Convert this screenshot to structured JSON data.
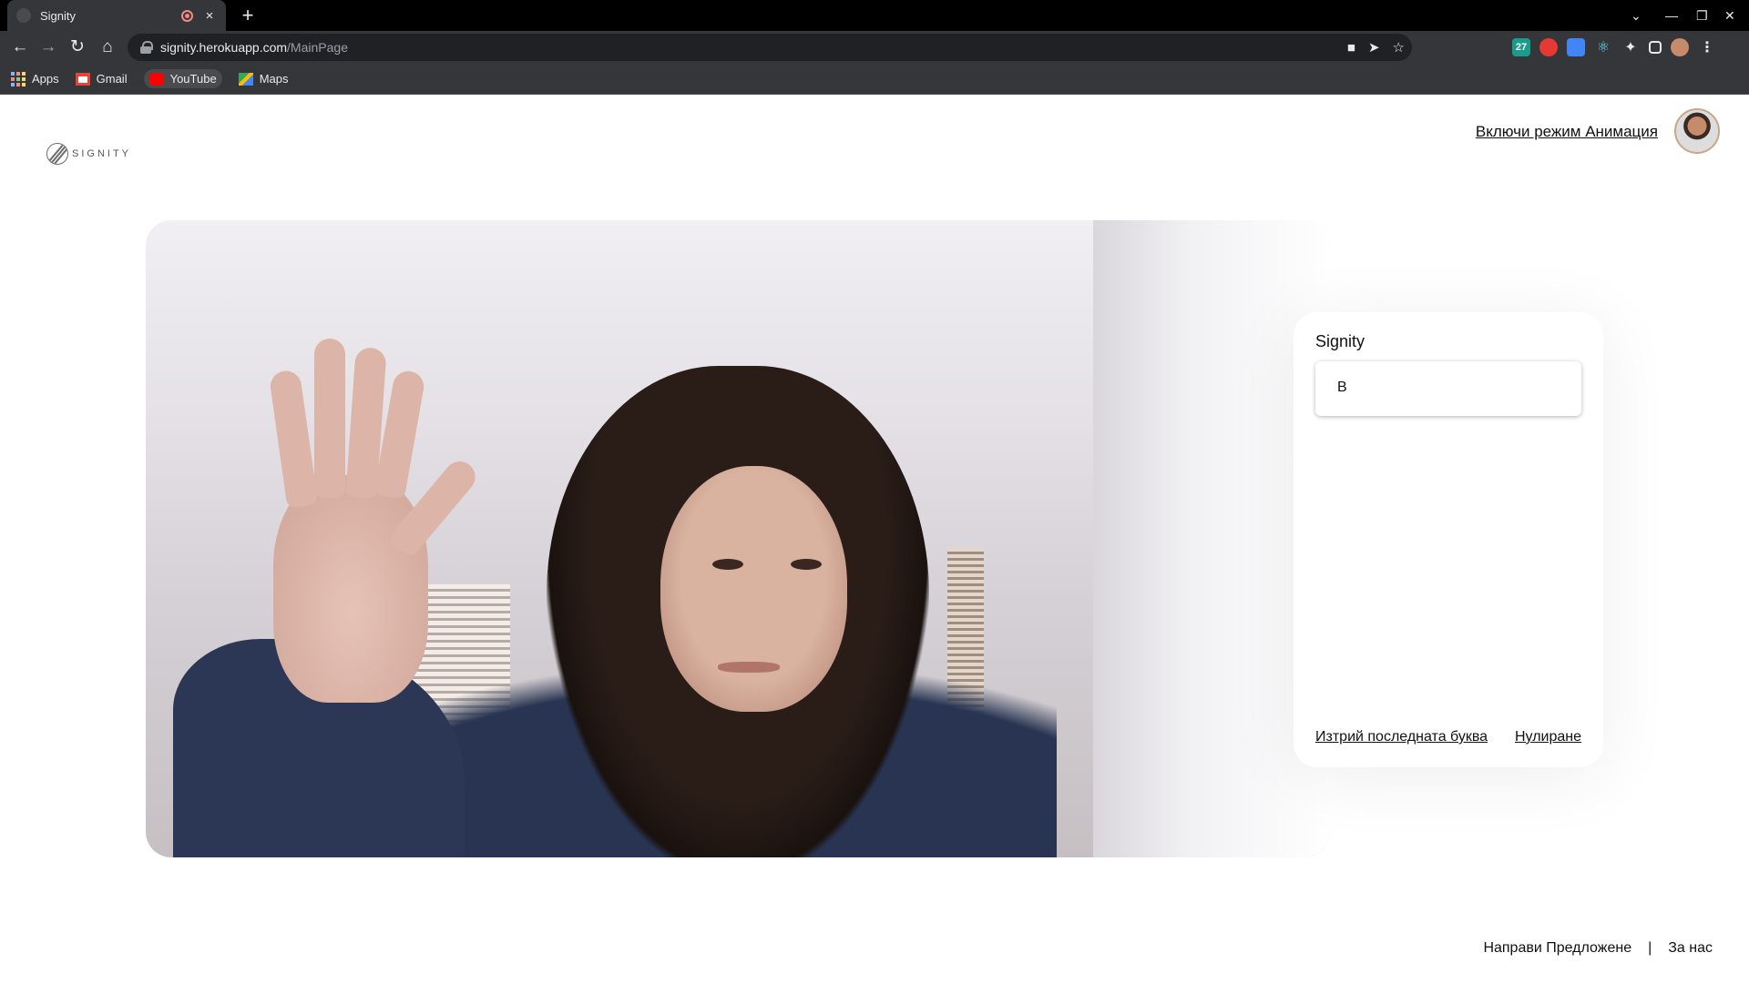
{
  "browser": {
    "tab_title": "Signity",
    "tab_close": "×",
    "new_tab": "+",
    "url_host": "signity.herokuapp.com",
    "url_path": "/MainPage",
    "bookmarks": [
      {
        "label": "Apps",
        "icon": "apps-grid-icon"
      },
      {
        "label": "Gmail",
        "icon": "gmail-icon",
        "color": "#ea4335"
      },
      {
        "label": "YouTube",
        "icon": "youtube-icon",
        "color": "#ff0000"
      },
      {
        "label": "Maps",
        "icon": "maps-icon",
        "color": "#34a853"
      }
    ],
    "extensions": [
      {
        "label": "27",
        "color": "#1a9c8c"
      },
      {
        "label": "",
        "color": "#e53935"
      },
      {
        "label": "",
        "color": "#4285f4"
      },
      {
        "label": "",
        "color": "#61dafb"
      }
    ]
  },
  "header": {
    "logo_text": "SIGNITY",
    "animation_link": "Включи режим Анимация"
  },
  "panel": {
    "title": "Signity",
    "output_text": "В",
    "delete_last_letter": "Изтрий последната буква",
    "reset": "Нулиране"
  },
  "footer": {
    "suggest_link": "Направи Предложене",
    "separator": "|",
    "about_link": "За нас"
  },
  "colors": {
    "tabbar_bg": "#000000",
    "toolbar_bg": "#35363a",
    "omnibox_bg": "#202124",
    "page_bg": "#ffffff"
  }
}
